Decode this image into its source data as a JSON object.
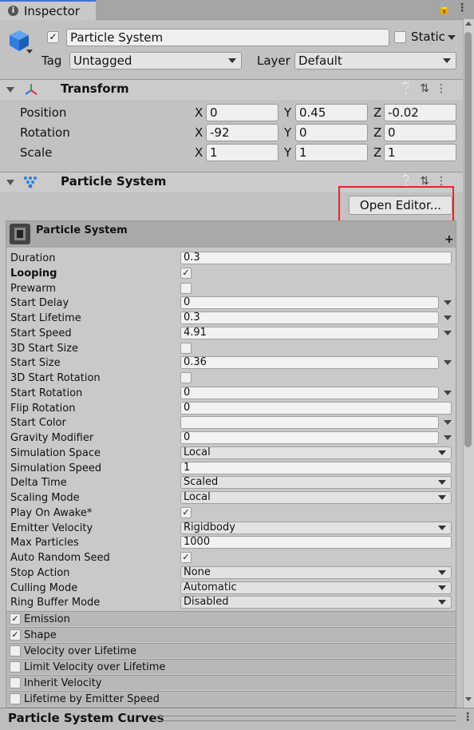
{
  "tab": {
    "title": "Inspector",
    "icon": "info-icon"
  },
  "header": {
    "object_name": "Particle System",
    "static_label": "Static",
    "tag_label": "Tag",
    "tag_value": "Untagged",
    "layer_label": "Layer",
    "layer_value": "Default"
  },
  "transform": {
    "title": "Transform",
    "rows": [
      {
        "label": "Position",
        "x": "0",
        "y": "0.45",
        "z": "-0.02"
      },
      {
        "label": "Rotation",
        "x": "-92",
        "y": "0",
        "z": "0"
      },
      {
        "label": "Scale",
        "x": "1",
        "y": "1",
        "z": "1"
      }
    ],
    "axis": {
      "x": "X",
      "y": "Y",
      "z": "Z"
    }
  },
  "particle_component": {
    "title": "Particle System",
    "open_editor_label": "Open Editor..."
  },
  "ps_module": {
    "title": "Particle System",
    "plus": "+",
    "rows": [
      {
        "name": "Duration",
        "type": "text",
        "value": "0.3"
      },
      {
        "name": "Looping",
        "type": "check",
        "checked": true,
        "bold": true
      },
      {
        "name": "Prewarm",
        "type": "check",
        "checked": false
      },
      {
        "name": "Start Delay",
        "type": "text_side",
        "value": "0"
      },
      {
        "name": "Start Lifetime",
        "type": "text_side",
        "value": "0.3"
      },
      {
        "name": "Start Speed",
        "type": "text_side",
        "value": "4.91"
      },
      {
        "name": "3D Start Size",
        "type": "check",
        "checked": false
      },
      {
        "name": "Start Size",
        "type": "text_side",
        "value": "0.36"
      },
      {
        "name": "3D Start Rotation",
        "type": "check",
        "checked": false
      },
      {
        "name": "Start Rotation",
        "type": "text_side",
        "value": "0"
      },
      {
        "name": "Flip Rotation",
        "type": "text",
        "value": "0"
      },
      {
        "name": "Start Color",
        "type": "text_side",
        "value": ""
      },
      {
        "name": "Gravity Modifier",
        "type": "text_side",
        "value": "0"
      },
      {
        "name": "Simulation Space",
        "type": "dropdown",
        "value": "Local"
      },
      {
        "name": "Simulation Speed",
        "type": "text",
        "value": "1"
      },
      {
        "name": "Delta Time",
        "type": "dropdown",
        "value": "Scaled"
      },
      {
        "name": "Scaling Mode",
        "type": "dropdown",
        "value": "Local"
      },
      {
        "name": "Play On Awake*",
        "type": "check",
        "checked": true
      },
      {
        "name": "Emitter Velocity",
        "type": "dropdown",
        "value": "Rigidbody"
      },
      {
        "name": "Max Particles",
        "type": "text",
        "value": "1000"
      },
      {
        "name": "Auto Random Seed",
        "type": "check",
        "checked": true
      },
      {
        "name": "Stop Action",
        "type": "dropdown",
        "value": "None"
      },
      {
        "name": "Culling Mode",
        "type": "dropdown",
        "value": "Automatic"
      },
      {
        "name": "Ring Buffer Mode",
        "type": "dropdown",
        "value": "Disabled"
      }
    ],
    "modules": [
      {
        "name": "Emission",
        "checked": true
      },
      {
        "name": "Shape",
        "checked": true
      },
      {
        "name": "Velocity over Lifetime",
        "checked": false
      },
      {
        "name": "Limit Velocity over Lifetime",
        "checked": false
      },
      {
        "name": "Inherit Velocity",
        "checked": false
      },
      {
        "name": "Lifetime by Emitter Speed",
        "checked": false
      }
    ]
  },
  "curves_panel": {
    "title": "Particle System Curves"
  },
  "colors": {
    "highlight": "#e8242a",
    "tab_accent": "#3a72d8",
    "cube_blue": "#2f7ee0"
  }
}
